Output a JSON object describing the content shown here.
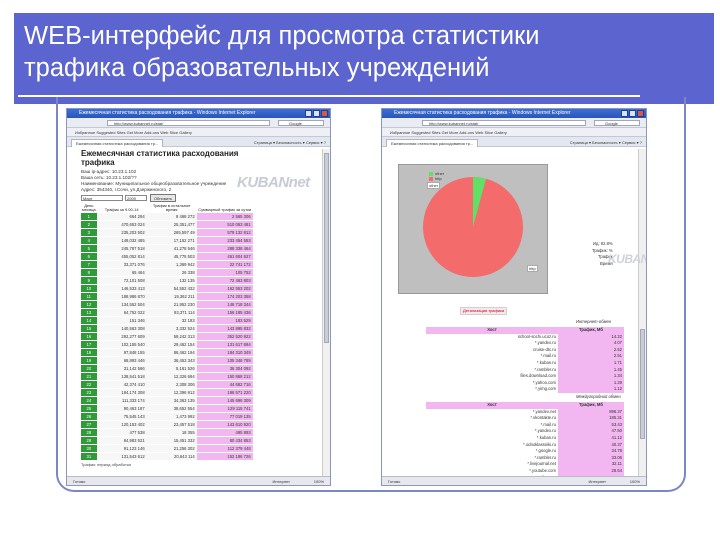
{
  "slide": {
    "title_line1": "WEB-интерфейс для просмотра статистики",
    "title_line2": "трафика образовательных учреждений",
    "brand_color": "#5b64cf"
  },
  "left_window": {
    "titlebar": "Ежемесячная статистика расходования трафика - Windows Internet Explorer",
    "url": "http://www.kubannet.ru/stat/",
    "search": "Google",
    "favorites": "Избранное   Suggested Sites   Get More Add-ons   Web Slice Gallery",
    "tab": "Ежемесячная статистика расходования тр...",
    "tools": "Страница ▾  Безопасность ▾  Сервис ▾  ?",
    "heading": "Ежемесячная статистика расходования трафика",
    "info": [
      "Ваш ip-адрес: 10.23.1.102",
      "Ваша сеть: 10.23.1.102/??",
      "Наименование: Муниципальное общеобразовательное учреждение",
      "Адрес: 354340, г.Сочи, ул.Дзержинского, 2"
    ],
    "select_month": "Март",
    "select_year": "2009",
    "button": "Обновить",
    "logo": "KUBANnet",
    "columns": [
      "День месяца",
      "Трафик за 9.00-14",
      "Трафик в остальное время",
      "Суммарный трафик за сутки"
    ],
    "rows": [
      [
        "1",
        "664 294",
        "8 468 272",
        "2 565 306"
      ],
      [
        "2",
        "470,653 024",
        "25,351,477",
        "510 063 481"
      ],
      [
        "3",
        "235,203 502",
        "265,597 49",
        "579 132 812"
      ],
      [
        "4",
        "148,032 485",
        "17,152 271",
        "233 454 553"
      ],
      [
        "5",
        "245,787 518",
        "41,278 546",
        "288 338 464"
      ],
      [
        "6",
        "455,052 814",
        "45,775 503",
        "461 604 627"
      ],
      [
        "7",
        "33,371 076",
        "1,369 942",
        "22 741 172"
      ],
      [
        "8",
        "65 464",
        "26 338",
        "105 752"
      ],
      [
        "9",
        "72,101 508",
        "132 135",
        "72 463 803"
      ],
      [
        "10",
        "146,533 413",
        "54,552 432",
        "162 553 202"
      ],
      [
        "11",
        "188,986 870",
        "19,362 211",
        "174 203 358"
      ],
      [
        "12",
        "134,552 504",
        "21,952 230",
        "146 718 344"
      ],
      [
        "13",
        "64,752 022",
        "93,371 114",
        "156 185 436"
      ],
      [
        "14",
        "151 346",
        "32 183",
        "183 529"
      ],
      [
        "15",
        "140,563 308",
        "3,332 524",
        "143 895 832"
      ],
      [
        "16",
        "292,277 609",
        "59,242 313",
        "352 520 922"
      ],
      [
        "17",
        "102,155 540",
        "29,462 154",
        "131 617 694"
      ],
      [
        "18",
        "97,848 155",
        "86,462 194",
        "184 310 349"
      ],
      [
        "19",
        "68,893 446",
        "36,453 343",
        "105 346 789"
      ],
      [
        "20",
        "31,142 566",
        "5,161 526",
        "36 304 092"
      ],
      [
        "21",
        "138,541 518",
        "12,326 694",
        "150 868 212"
      ],
      [
        "22",
        "42,374 410",
        "2,308 306",
        "44 682 716"
      ],
      [
        "23",
        "184,174 308",
        "12,396 912",
        "196 571 220"
      ],
      [
        "24",
        "111,333 174",
        "34,363 135",
        "145 696 309"
      ],
      [
        "25",
        "90,463 187",
        "38,652 554",
        "129 115 741"
      ],
      [
        "26",
        "75,545 143",
        "1,473 992",
        "77 019 135"
      ],
      [
        "27",
        "120,153 402",
        "23,457 518",
        "143 610 920"
      ],
      [
        "28",
        "477 538",
        "18 355",
        "495 893"
      ],
      [
        "29",
        "64,983 521",
        "15,451 332",
        "80 434 853"
      ],
      [
        "30",
        "91,123 146",
        "21,256 302",
        "112 379 448"
      ],
      [
        "31",
        "131,543 612",
        "20,643 114",
        "152 186 726"
      ]
    ],
    "footer": "Трафик: период обработки",
    "status": "Готово",
    "zone": "Интернет",
    "zoom": "100%"
  },
  "right_window": {
    "titlebar": "Ежемесячная статистика расходования трафика - Windows Internet Explorer",
    "url": "http://www.kubannet.ru/stat/",
    "search": "Google",
    "favorites": "Избранное   Suggested Sites   Get More Add-ons   Web Slice Gallery",
    "tab": "Ежемесячная статистика расходования тр...",
    "tools": "Страница ▾  Безопасность ▾  Сервис ▾  ?",
    "chart_legend": [
      "other",
      "http"
    ],
    "chart_label_other": "other",
    "chart_label_http": "http",
    "colors": {
      "http": "#f36b6b",
      "other": "#62e065",
      "chart_bg": "#bfbfbf"
    },
    "summary": [
      "Ид: 92.8%",
      "Трафик: %",
      "Трафик",
      "Время"
    ],
    "logo": "KUBANnet",
    "link": "Детализация трафика",
    "section1_title": "Интернет-обмен",
    "section2_title": "Междугородний обмен",
    "host_header": "Хост",
    "traffic_header": "Трафик, Мб",
    "table1": [
      [
        "school-sochi.ucoz.ru",
        "14.22"
      ],
      [
        "*.yandex.ru",
        "4.07"
      ],
      [
        "cruise-dtc.ru",
        "2.52"
      ],
      [
        "*.mail.ru",
        "2.51"
      ],
      [
        "*.kuban.ru",
        "1.71"
      ],
      [
        "*.rambler.ru",
        "1.45"
      ],
      [
        "files.download.com",
        "1.34"
      ],
      [
        "*.yahoo.com",
        "1.29"
      ],
      [
        "*.yimg.com",
        "1.12"
      ]
    ],
    "table2": [
      [
        "*.yandex.net",
        "896.37"
      ],
      [
        "*.vkontakte.ru",
        "185.31"
      ],
      [
        "*.mail.ru",
        "53.43"
      ],
      [
        "*.yandex.ru",
        "47.50"
      ],
      [
        "*.kuban.ru",
        "41.12"
      ],
      [
        "*.odnoklassniki.ru",
        "40.37"
      ],
      [
        "*.google.ru",
        "34.78"
      ],
      [
        "*.rambler.ru",
        "33.06"
      ],
      [
        "*.livejournal.net",
        "32.11"
      ],
      [
        "*.youtube.com",
        "28.54"
      ],
      [
        "*.moikrug.ru",
        "25.07"
      ],
      [
        "*.gstatic.com",
        "19.09"
      ],
      [
        "*.ytimg.com",
        "15.51"
      ],
      [
        "*.qip.ru",
        "12.79"
      ],
      [
        "*.msn.com",
        "10.02"
      ]
    ],
    "status": "Готово",
    "zone": "Интернет",
    "zoom": "100%"
  }
}
